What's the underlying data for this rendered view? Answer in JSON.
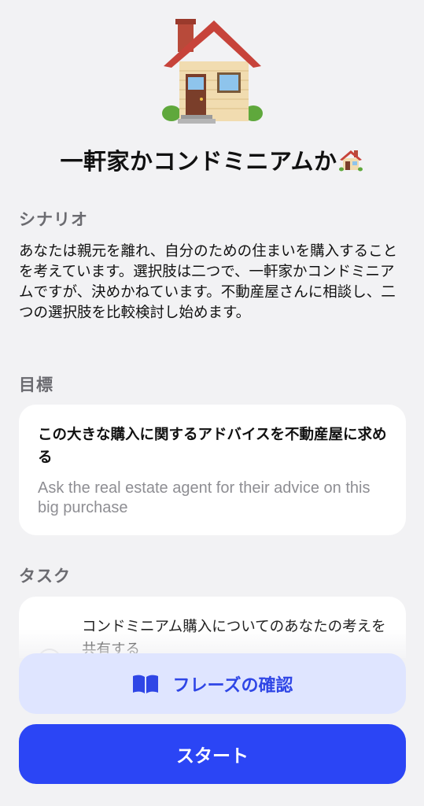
{
  "header": {
    "hero_icon": "house-icon",
    "title": "一軒家かコンドミニアムか",
    "title_emoji": "house-icon"
  },
  "scenario": {
    "label": "シナリオ",
    "text": "あなたは親元を離れ、自分のための住まいを購入することを考えています。選択肢は二つで、一軒家かコンドミニアムですが、決めかねています。不動産屋さんに相談し、二つの選択肢を比較検討し始めます。"
  },
  "goal": {
    "label": "目標",
    "text_jp": "この大きな購入に関するアドバイスを不動産屋に求める",
    "text_en": "Ask the real estate agent for their advice on this big purchase"
  },
  "tasks": {
    "label": "タスク",
    "items": [
      {
        "text": "コンドミニアム購入についてのあなたの考えを共有する",
        "completed": false
      }
    ]
  },
  "actions": {
    "phrases_label": "フレーズの確認",
    "phrases_icon": "book-icon",
    "start_label": "スタート"
  },
  "colors": {
    "primary": "#2b45f5",
    "primary_light": "#dfe5ff",
    "primary_text": "#2f46e6",
    "background": "#f2f2f4",
    "muted": "#8e8e93"
  }
}
